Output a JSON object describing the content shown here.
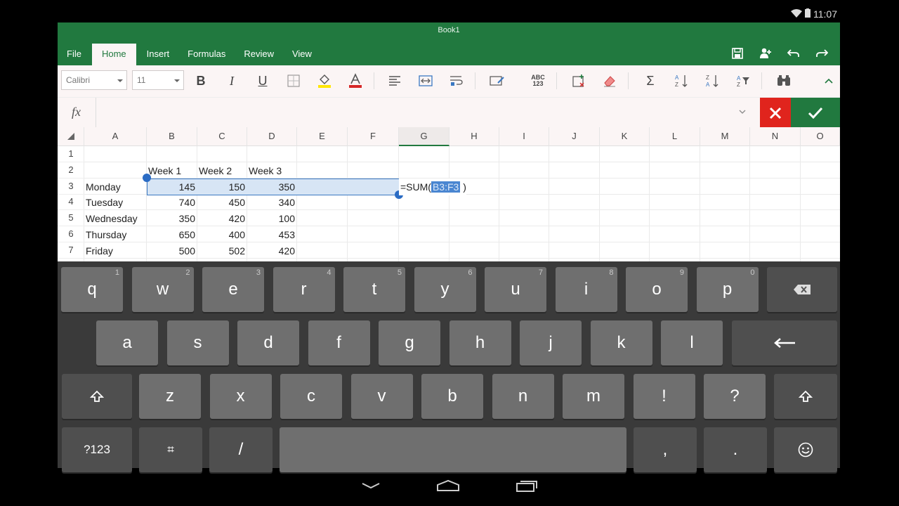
{
  "status_bar": {
    "time": "11:07"
  },
  "window": {
    "title": "Book1"
  },
  "tabs": [
    {
      "label": "File",
      "active": false
    },
    {
      "label": "Home",
      "active": true
    },
    {
      "label": "Insert",
      "active": false
    },
    {
      "label": "Formulas",
      "active": false
    },
    {
      "label": "Review",
      "active": false
    },
    {
      "label": "View",
      "active": false
    }
  ],
  "title_actions": [
    "save-icon",
    "share-icon",
    "undo-icon",
    "redo-icon"
  ],
  "ribbon": {
    "font_name": "Calibri",
    "font_size": "11",
    "bold": "B",
    "italic": "I",
    "underline": "U",
    "number_format_label": "ABC\n123",
    "sum": "Σ",
    "accent_color": "#21793f",
    "font_color_bar": "#d62828",
    "fill_color_bar": "#ffe600"
  },
  "formula_bar": {
    "fx": "fx",
    "value": "",
    "cancel_color": "#e0241d",
    "confirm_color": "#21793f"
  },
  "grid": {
    "columns": [
      "A",
      "B",
      "C",
      "D",
      "E",
      "F",
      "G",
      "H",
      "I",
      "J",
      "K",
      "L",
      "M",
      "N",
      "O"
    ],
    "selected_column": "G",
    "rows": [
      "1",
      "2",
      "3",
      "4",
      "5",
      "6",
      "7"
    ],
    "cells": {
      "B2": "Week 1",
      "C2": "Week 2",
      "D2": "Week 3",
      "A3": "Monday",
      "B3": "145",
      "C3": "150",
      "D3": "350",
      "A4": "Tuesday",
      "B4": "740",
      "C4": "450",
      "D4": "340",
      "A5": "Wednesday",
      "B5": "350",
      "C5": "420",
      "D5": "100",
      "A6": "Thursday",
      "B6": "650",
      "C6": "400",
      "D6": "453",
      "A7": "Friday",
      "B7": "500",
      "C7": "502",
      "D7": "420"
    },
    "active_formula": {
      "prefix": "=SUM(",
      "range": "B3:F3",
      "suffix": " )"
    }
  },
  "keyboard": {
    "row1": [
      {
        "k": "q",
        "h": "1"
      },
      {
        "k": "w",
        "h": "2"
      },
      {
        "k": "e",
        "h": "3"
      },
      {
        "k": "r",
        "h": "4"
      },
      {
        "k": "t",
        "h": "5"
      },
      {
        "k": "y",
        "h": "6"
      },
      {
        "k": "u",
        "h": "7"
      },
      {
        "k": "i",
        "h": "8"
      },
      {
        "k": "o",
        "h": "9"
      },
      {
        "k": "p",
        "h": "0"
      }
    ],
    "row2": [
      "a",
      "s",
      "d",
      "f",
      "g",
      "h",
      "j",
      "k",
      "l"
    ],
    "row3": [
      "z",
      "x",
      "c",
      "v",
      "b",
      "n",
      "m",
      "!",
      "?"
    ],
    "row4": {
      "symbols": "?123",
      "settings": "⌗",
      "slash": "/",
      "comma": ",",
      "period": "."
    }
  }
}
